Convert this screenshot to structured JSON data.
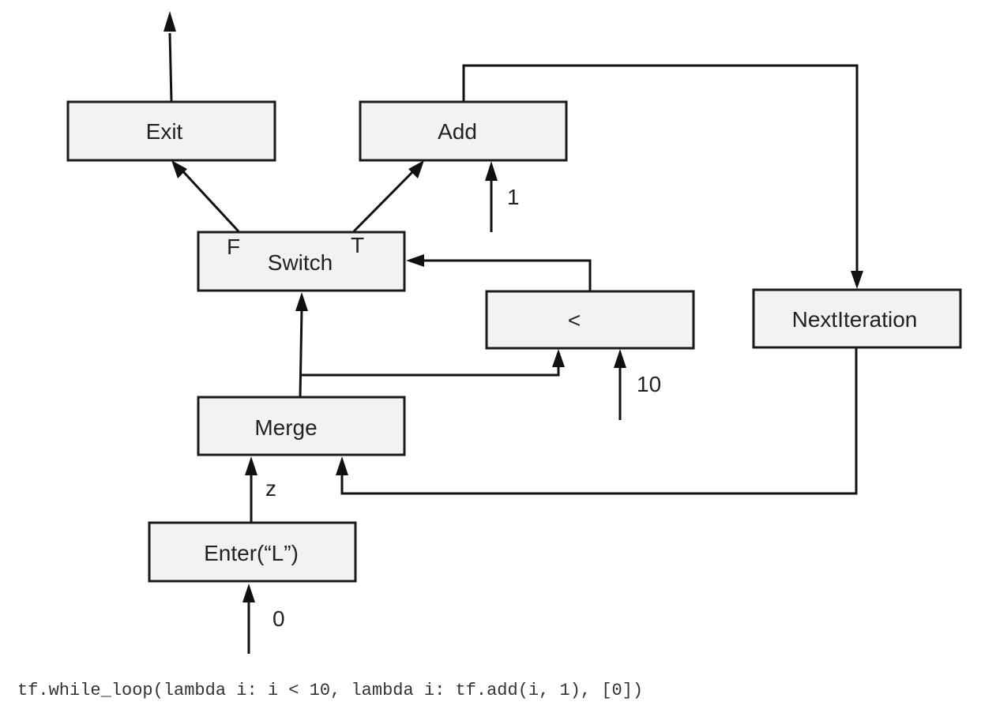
{
  "diagram": {
    "nodes": {
      "exit": "Exit",
      "add": "Add",
      "switch": "Switch",
      "less": "<",
      "next_iteration": "NextIteration",
      "merge": "Merge",
      "enter": "Enter(“L”)"
    },
    "switch_ports": {
      "false": "F",
      "true": "T"
    },
    "edge_labels": {
      "add_input": "1",
      "less_input": "10",
      "enter_to_merge": "z",
      "enter_input": "0"
    }
  },
  "caption": "tf.while_loop(lambda i: i < 10, lambda i: tf.add(i, 1), [0])"
}
